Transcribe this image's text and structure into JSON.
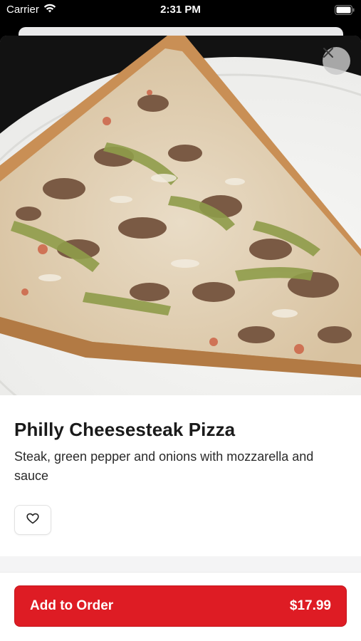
{
  "status_bar": {
    "carrier": "Carrier",
    "time": "2:31 PM",
    "wifi_icon": "wifi-icon",
    "battery_icon": "battery-icon"
  },
  "item": {
    "image": "pizza-slice-photo",
    "name": "Philly Cheesesteak Pizza",
    "description": "Steak, green pepper and onions with mozzarella and sauce",
    "favorite_icon": "heart-icon"
  },
  "actions": {
    "close_icon": "close-icon",
    "add_label": "Add to Order",
    "price": "$17.99"
  },
  "colors": {
    "accent": "#de1c24",
    "sheet": "#ffffff",
    "background": "#000000"
  }
}
